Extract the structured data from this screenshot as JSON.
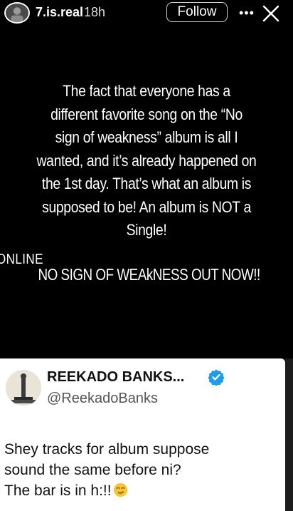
{
  "story": {
    "username": "7.is.real",
    "timestamp": "18h",
    "follow_label": "Follow",
    "more_icon": "more-horizontal-icon",
    "close_icon": "close-icon",
    "text_lines": [
      "The fact that everyone has a",
      "different favorite song on the “No",
      "sign of weakness” album is all I",
      "wanted, and it’s already happened on",
      "the 1st day. That’s what an album is",
      "supposed to be! An album is NOT a",
      "Single!"
    ],
    "online_label": "ONLINE",
    "out_now": "NO SIGN OF WEAkNESS OUT NOW!!"
  },
  "tweet": {
    "display_name": "REEKADO BANKS...",
    "handle": "@ReekadoBanks",
    "verified_icon": "verified-badge-icon",
    "body_lines": [
      "Shey tracks for album suppose",
      "sound the same before ni?",
      "The bar is in h:!!"
    ],
    "emoji": "smirking-face-icon"
  },
  "colors": {
    "background": "#000000",
    "card": "#ffffff",
    "verified": "#1d9bf0"
  }
}
